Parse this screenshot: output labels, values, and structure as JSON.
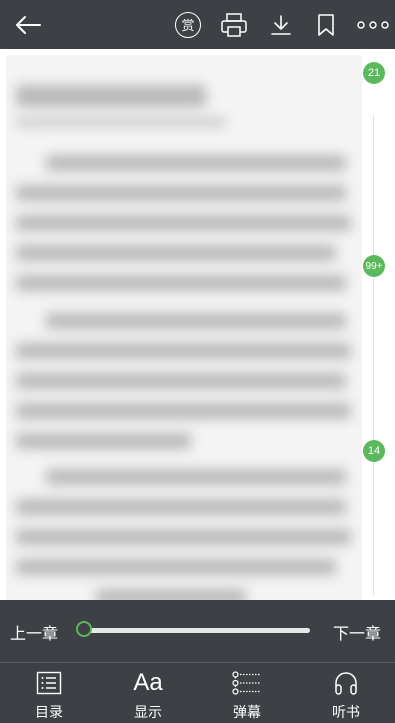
{
  "topbar": {
    "reward_glyph": "赏",
    "icons": [
      "back-arrow-icon",
      "reward-icon",
      "print-icon",
      "download-icon",
      "bookmark-icon",
      "more-icon"
    ]
  },
  "comment_bubbles": [
    "21",
    "99+",
    "14"
  ],
  "progress": {
    "prev_label": "上一章",
    "next_label": "下一章",
    "value": 0
  },
  "bottom_nav": [
    {
      "label": "目录",
      "icon": "toc-list-icon"
    },
    {
      "label": "显示",
      "icon": "font-aa-icon",
      "glyph": "Aa"
    },
    {
      "label": "弹幕",
      "icon": "danmaku-icon"
    },
    {
      "label": "听书",
      "icon": "headphones-icon"
    }
  ],
  "colors": {
    "bar_bg": "#3d4045",
    "accent": "#5cb85c",
    "page_bg": "#f4f4f4"
  }
}
